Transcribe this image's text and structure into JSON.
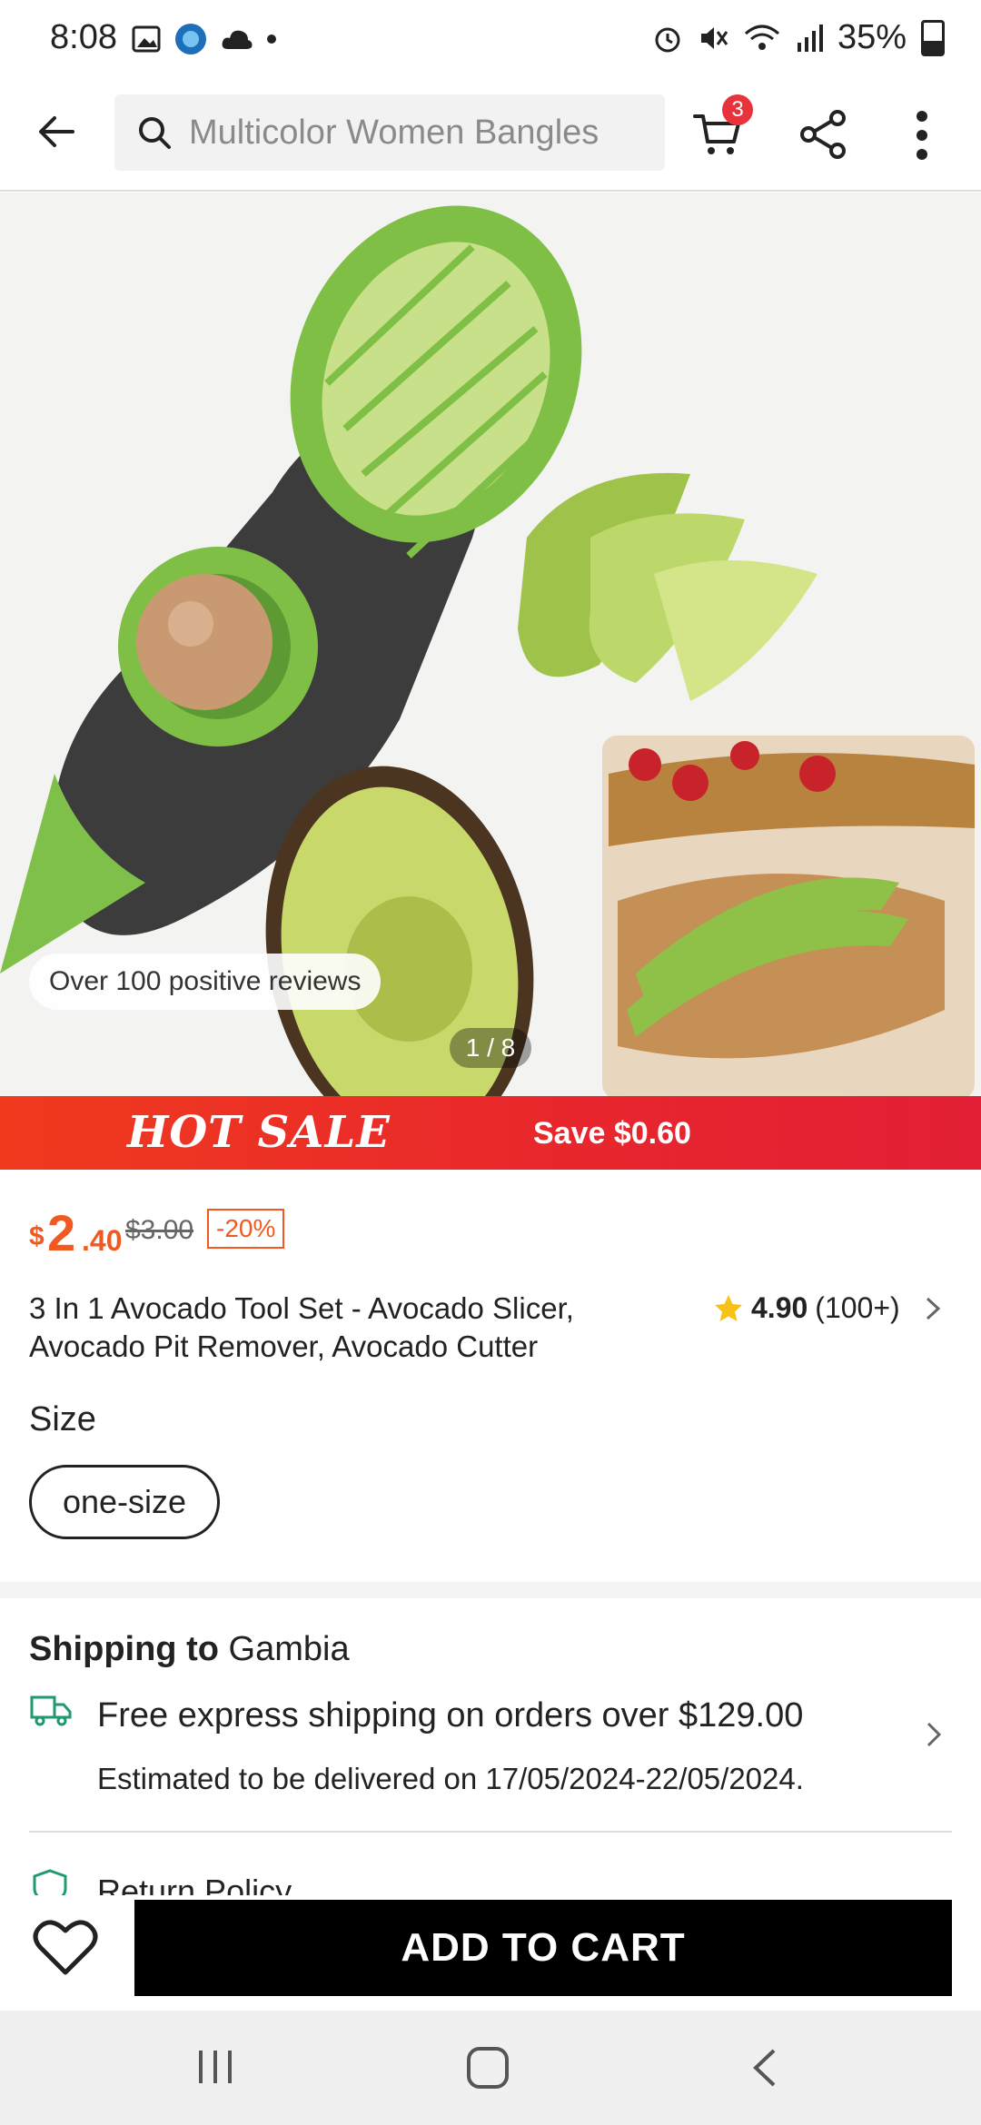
{
  "status_bar": {
    "time": "8:08",
    "battery": "35%"
  },
  "search": {
    "placeholder": "Multicolor Women Bangles"
  },
  "cart": {
    "badge_count": "3"
  },
  "gallery": {
    "reviews_badge": "Over 100 positive reviews",
    "counter": "1 / 8"
  },
  "promo": {
    "title": "HOT SALE",
    "save_text": "Save $0.60"
  },
  "price": {
    "currency": "$",
    "integer": "2",
    "decimal": ".40",
    "original": "$3.00",
    "discount": "-20%"
  },
  "product": {
    "title": "3 In 1 Avocado Tool Set - Avocado Slicer, Avocado Pit Remover, Avocado Cutter",
    "rating": "4.90",
    "rating_count": "(100+)"
  },
  "size": {
    "label": "Size",
    "selected": "one-size"
  },
  "shipping": {
    "title_prefix": "Shipping to",
    "country": "Gambia",
    "free_text": "Free express shipping on orders over $129.00",
    "estimate": "Estimated to be delivered on 17/05/2024-22/05/2024.",
    "return_policy": "Return Policy"
  },
  "actions": {
    "add_to_cart": "ADD TO CART"
  },
  "colors": {
    "accent": "#f05a22",
    "sale_red": "#e8262d",
    "cart_badge": "#e8323c"
  }
}
